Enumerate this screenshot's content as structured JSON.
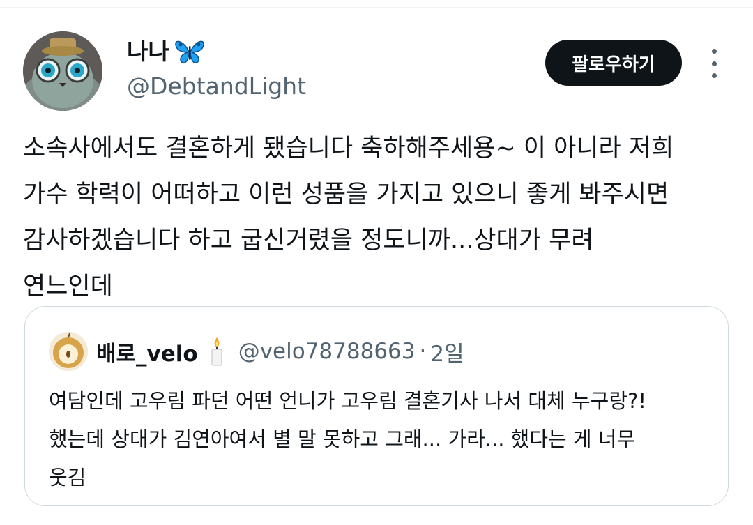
{
  "tweet": {
    "author_name": "나나",
    "author_emoji": "butterfly",
    "author_handle": "@DebtandLight",
    "follow_label": "팔로우하기",
    "text_lines": [
      "소속사에서도 결혼하게 됐습니다 축하해주세용~ 이 아니라 저희",
      "가수 학력이 어떠하고 이런 성품을 가지고 있으니 좋게 봐주시면",
      "감사하겠습니다 하고 굽신거렸을 정도니까...상대가 무려",
      "연느인데"
    ]
  },
  "quoted_tweet": {
    "author_name": "배로_velo",
    "author_emoji": "candle",
    "author_handle": "@velo78788663",
    "separator": "·",
    "time": "2일",
    "text_lines": [
      "여담인데 고우림 파던 어떤 언니가 고우림 결혼기사 나서 대체 누구랑?!",
      "했는데 상대가 김연아여서 별 말 못하고 그래... 가라... 했다는 게 너무",
      "웃김"
    ]
  },
  "colors": {
    "text_primary": "#0f1419",
    "text_secondary": "#536471",
    "button_bg": "#0f1419",
    "border": "#cfd9de"
  }
}
